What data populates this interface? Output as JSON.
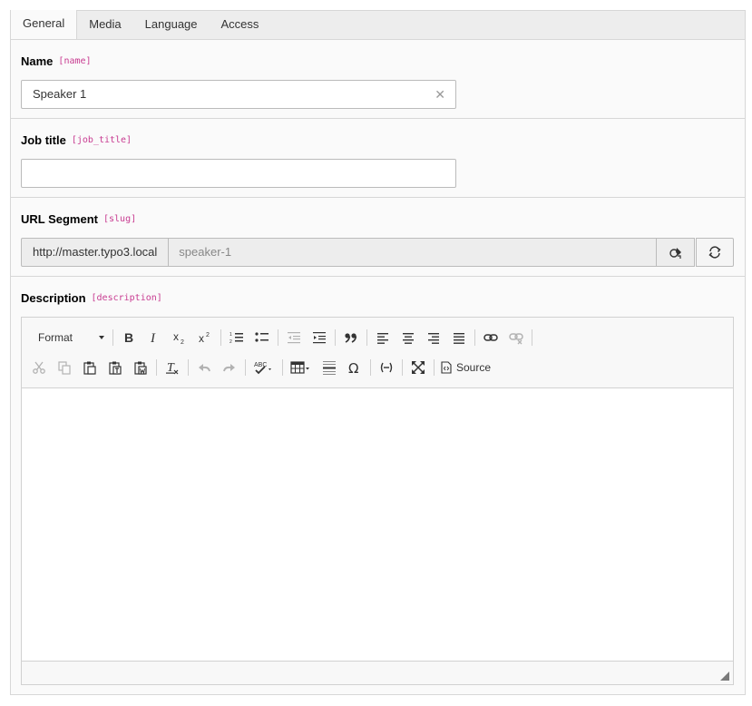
{
  "tabs": [
    {
      "label": "General",
      "active": true
    },
    {
      "label": "Media",
      "active": false
    },
    {
      "label": "Language",
      "active": false
    },
    {
      "label": "Access",
      "active": false
    }
  ],
  "fields": {
    "name": {
      "label": "Name",
      "key": "[name]",
      "value": "Speaker 1"
    },
    "job_title": {
      "label": "Job title",
      "key": "[job_title]",
      "value": ""
    },
    "slug": {
      "label": "URL Segment",
      "key": "[slug]",
      "prefix": "http://master.typo3.local",
      "value": "speaker-1"
    },
    "description": {
      "label": "Description",
      "key": "[description]"
    }
  },
  "editor": {
    "format_label": "Format",
    "source_label": "Source",
    "toolbar_row1": [
      "bold-icon",
      "italic-icon",
      "subscript-icon",
      "superscript-icon",
      "numbered-list-icon",
      "bulleted-list-icon",
      "outdent-icon",
      "indent-icon",
      "blockquote-icon",
      "align-left-icon",
      "align-center-icon",
      "align-right-icon",
      "justify-icon",
      "link-icon",
      "unlink-icon"
    ],
    "toolbar_row2": [
      "cut-icon",
      "copy-icon",
      "paste-icon",
      "paste-text-icon",
      "paste-word-icon",
      "remove-format-icon",
      "undo-icon",
      "redo-icon",
      "spellcheck-icon",
      "table-icon",
      "horizontal-line-icon",
      "special-char-icon",
      "soft-hyphen-icon",
      "maximize-icon",
      "source-icon"
    ]
  },
  "colors": {
    "field_key": "#c83c91",
    "tab_bar": "#ededed",
    "panel": "#fafafa",
    "border": "#d7d7d7"
  }
}
